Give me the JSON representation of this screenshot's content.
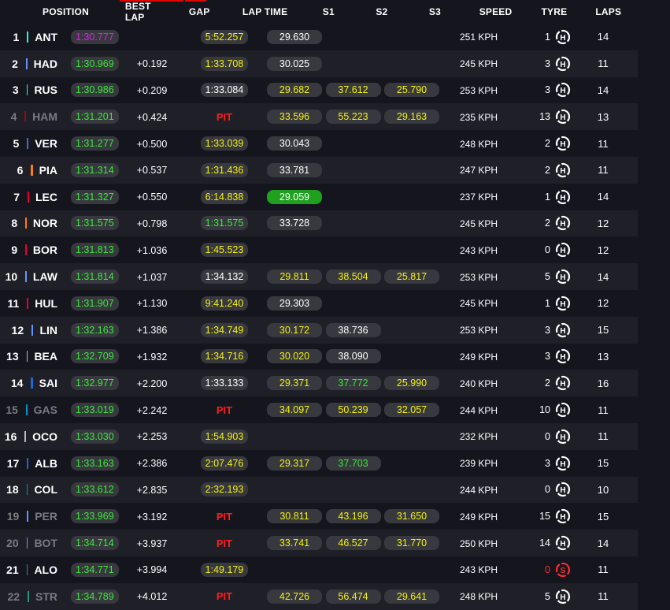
{
  "header": {
    "position": "POSITION",
    "best_lap": "BEST LAP",
    "gap": "GAP",
    "lap_time": "LAP TIME",
    "s1": "S1",
    "s2": "S2",
    "s3": "S3",
    "speed": "SPEED",
    "tyre": "TYRE",
    "laps": "LAPS"
  },
  "colors": {
    "background": "#15151e",
    "row_alt": "#1f1f27",
    "purple": "#d12bd8",
    "green": "#3be83b",
    "yellow": "#f2f20f",
    "pit": "#ff1d1d",
    "accent": "#e10600"
  },
  "rows": [
    {
      "pos": "1",
      "team_color": "#27f4d2",
      "driver": "ANT",
      "best": "1:30.777",
      "best_c": "purple",
      "gap": "",
      "lap": "5:52.257",
      "lap_c": "yellow",
      "s1": "29.630",
      "s1_c": "white",
      "s2": "",
      "s2_c": "",
      "s3": "",
      "s3_c": "",
      "speed": "251 KPH",
      "stint": "1",
      "tyre": "H",
      "laps": "14",
      "pit": false
    },
    {
      "pos": "2",
      "team_color": "#6692ff",
      "driver": "HAD",
      "best": "1:30.969",
      "best_c": "green",
      "gap": "+0.192",
      "lap": "1:33.708",
      "lap_c": "yellow",
      "s1": "30.025",
      "s1_c": "white",
      "s2": "",
      "s2_c": "",
      "s3": "",
      "s3_c": "",
      "speed": "245 KPH",
      "stint": "3",
      "tyre": "H",
      "laps": "11",
      "pit": false
    },
    {
      "pos": "3",
      "team_color": "#27f4d2",
      "driver": "RUS",
      "best": "1:30.986",
      "best_c": "green",
      "gap": "+0.209",
      "lap": "1:33.084",
      "lap_c": "white",
      "s1": "29.682",
      "s1_c": "yellow",
      "s2": "37.612",
      "s2_c": "yellow",
      "s3": "25.790",
      "s3_c": "yellow",
      "speed": "253 KPH",
      "stint": "3",
      "tyre": "H",
      "laps": "14",
      "pit": false
    },
    {
      "pos": "4",
      "team_color": "#8b0a1e",
      "driver": "HAM",
      "best": "1:31.201",
      "best_c": "green",
      "gap": "+0.424",
      "lap": "PIT",
      "lap_c": "pit",
      "s1": "33.596",
      "s1_c": "yellow",
      "s2": "55.223",
      "s2_c": "yellow",
      "s3": "29.163",
      "s3_c": "yellow",
      "speed": "235 KPH",
      "stint": "13",
      "tyre": "H",
      "laps": "13",
      "pit": true
    },
    {
      "pos": "5",
      "team_color": "#3671c6",
      "driver": "VER",
      "best": "1:31.277",
      "best_c": "green",
      "gap": "+0.500",
      "lap": "1:33.039",
      "lap_c": "yellow",
      "s1": "30.043",
      "s1_c": "white",
      "s2": "",
      "s2_c": "",
      "s3": "",
      "s3_c": "",
      "speed": "248 KPH",
      "stint": "2",
      "tyre": "H",
      "laps": "11",
      "pit": false
    },
    {
      "pos": "6",
      "team_color": "#ff8000",
      "driver": "PIA",
      "best": "1:31.314",
      "best_c": "green",
      "gap": "+0.537",
      "lap": "1:31.436",
      "lap_c": "yellow",
      "s1": "33.781",
      "s1_c": "white",
      "s2": "",
      "s2_c": "",
      "s3": "",
      "s3_c": "",
      "speed": "247 KPH",
      "stint": "2",
      "tyre": "H",
      "laps": "11",
      "pit": false
    },
    {
      "pos": "7",
      "team_color": "#e8002d",
      "driver": "LEC",
      "best": "1:31.327",
      "best_c": "green",
      "gap": "+0.550",
      "lap": "6:14.838",
      "lap_c": "yellow",
      "s1": "29.059",
      "s1_c": "fastbg",
      "s2": "",
      "s2_c": "",
      "s3": "",
      "s3_c": "",
      "speed": "237 KPH",
      "stint": "1",
      "tyre": "H",
      "laps": "14",
      "pit": false
    },
    {
      "pos": "8",
      "team_color": "#ff8000",
      "driver": "NOR",
      "best": "1:31.575",
      "best_c": "green",
      "gap": "+0.798",
      "lap": "1:31.575",
      "lap_c": "green",
      "s1": "33.728",
      "s1_c": "white",
      "s2": "",
      "s2_c": "",
      "s3": "",
      "s3_c": "",
      "speed": "245 KPH",
      "stint": "2",
      "tyre": "H",
      "laps": "12",
      "pit": false
    },
    {
      "pos": "9",
      "team_color": "#e8002d",
      "driver": "BOR",
      "best": "1:31.813",
      "best_c": "green",
      "gap": "+1.036",
      "lap": "1:45.523",
      "lap_c": "yellow",
      "s1": "",
      "s1_c": "",
      "s2": "",
      "s2_c": "",
      "s3": "",
      "s3_c": "",
      "speed": "243 KPH",
      "stint": "0",
      "tyre": "H",
      "laps": "12",
      "pit": false
    },
    {
      "pos": "10",
      "team_color": "#6692ff",
      "driver": "LAW",
      "best": "1:31.814",
      "best_c": "green",
      "gap": "+1.037",
      "lap": "1:34.132",
      "lap_c": "white",
      "s1": "29.811",
      "s1_c": "yellow",
      "s2": "38.504",
      "s2_c": "yellow",
      "s3": "25.817",
      "s3_c": "yellow",
      "speed": "253 KPH",
      "stint": "5",
      "tyre": "H",
      "laps": "14",
      "pit": false
    },
    {
      "pos": "11",
      "team_color": "#e8002d",
      "driver": "HUL",
      "best": "1:31.907",
      "best_c": "green",
      "gap": "+1.130",
      "lap": "9:41.240",
      "lap_c": "yellow",
      "s1": "29.303",
      "s1_c": "white",
      "s2": "",
      "s2_c": "",
      "s3": "",
      "s3_c": "",
      "speed": "245 KPH",
      "stint": "1",
      "tyre": "H",
      "laps": "12",
      "pit": false
    },
    {
      "pos": "12",
      "team_color": "#6692ff",
      "driver": "LIN",
      "best": "1:32.163",
      "best_c": "green",
      "gap": "+1.386",
      "lap": "1:34.749",
      "lap_c": "yellow",
      "s1": "30.172",
      "s1_c": "yellow",
      "s2": "38.736",
      "s2_c": "white",
      "s3": "",
      "s3_c": "",
      "speed": "253 KPH",
      "stint": "3",
      "tyre": "H",
      "laps": "15",
      "pit": false
    },
    {
      "pos": "13",
      "team_color": "#b6babd",
      "driver": "BEA",
      "best": "1:32.709",
      "best_c": "green",
      "gap": "+1.932",
      "lap": "1:34.716",
      "lap_c": "yellow",
      "s1": "30.020",
      "s1_c": "yellow",
      "s2": "38.090",
      "s2_c": "white",
      "s3": "",
      "s3_c": "",
      "speed": "249 KPH",
      "stint": "3",
      "tyre": "H",
      "laps": "13",
      "pit": false
    },
    {
      "pos": "14",
      "team_color": "#1868db",
      "driver": "SAI",
      "best": "1:32.977",
      "best_c": "green",
      "gap": "+2.200",
      "lap": "1:33.133",
      "lap_c": "white",
      "s1": "29.371",
      "s1_c": "yellow",
      "s2": "37.772",
      "s2_c": "green",
      "s3": "25.990",
      "s3_c": "yellow",
      "speed": "240 KPH",
      "stint": "2",
      "tyre": "H",
      "laps": "16",
      "pit": false
    },
    {
      "pos": "15",
      "team_color": "#0093cc",
      "driver": "GAS",
      "best": "1:33.019",
      "best_c": "green",
      "gap": "+2.242",
      "lap": "PIT",
      "lap_c": "pit",
      "s1": "34.097",
      "s1_c": "yellow",
      "s2": "50.239",
      "s2_c": "yellow",
      "s3": "32.057",
      "s3_c": "yellow",
      "speed": "244 KPH",
      "stint": "10",
      "tyre": "H",
      "laps": "11",
      "pit": true
    },
    {
      "pos": "16",
      "team_color": "#b6babd",
      "driver": "OCO",
      "best": "1:33.030",
      "best_c": "green",
      "gap": "+2.253",
      "lap": "1:54.903",
      "lap_c": "yellow",
      "s1": "",
      "s1_c": "",
      "s2": "",
      "s2_c": "",
      "s3": "",
      "s3_c": "",
      "speed": "232 KPH",
      "stint": "0",
      "tyre": "H",
      "laps": "11",
      "pit": false
    },
    {
      "pos": "17",
      "team_color": "#1868db",
      "driver": "ALB",
      "best": "1:33.163",
      "best_c": "green",
      "gap": "+2.386",
      "lap": "2:07.476",
      "lap_c": "yellow",
      "s1": "29.317",
      "s1_c": "yellow",
      "s2": "37.703",
      "s2_c": "green",
      "s3": "",
      "s3_c": "",
      "speed": "239 KPH",
      "stint": "3",
      "tyre": "H",
      "laps": "15",
      "pit": false
    },
    {
      "pos": "18",
      "team_color": "#0093cc",
      "driver": "COL",
      "best": "1:33.612",
      "best_c": "green",
      "gap": "+2.835",
      "lap": "2:32.193",
      "lap_c": "yellow",
      "s1": "",
      "s1_c": "",
      "s2": "",
      "s2_c": "",
      "s3": "",
      "s3_c": "",
      "speed": "244 KPH",
      "stint": "0",
      "tyre": "H",
      "laps": "10",
      "pit": false
    },
    {
      "pos": "19",
      "team_color": "#6692ff",
      "driver": "PER",
      "best": "1:33.969",
      "best_c": "green",
      "gap": "+3.192",
      "lap": "PIT",
      "lap_c": "pit",
      "s1": "30.811",
      "s1_c": "yellow",
      "s2": "43.196",
      "s2_c": "yellow",
      "s3": "31.650",
      "s3_c": "yellow",
      "speed": "249 KPH",
      "stint": "15",
      "tyre": "H",
      "laps": "15",
      "pit": true
    },
    {
      "pos": "20",
      "team_color": "#6692ff",
      "driver": "BOT",
      "best": "1:34.714",
      "best_c": "green",
      "gap": "+3.937",
      "lap": "PIT",
      "lap_c": "pit",
      "s1": "33.741",
      "s1_c": "yellow",
      "s2": "46.527",
      "s2_c": "yellow",
      "s3": "31.770",
      "s3_c": "yellow",
      "speed": "250 KPH",
      "stint": "14",
      "tyre": "H",
      "laps": "14",
      "pit": true
    },
    {
      "pos": "21",
      "team_color": "#229971",
      "driver": "ALO",
      "best": "1:34.771",
      "best_c": "green",
      "gap": "+3.994",
      "lap": "1:49.179",
      "lap_c": "yellow",
      "s1": "",
      "s1_c": "",
      "s2": "",
      "s2_c": "",
      "s3": "",
      "s3_c": "",
      "speed": "243 KPH",
      "stint": "0",
      "stint_c": "red",
      "tyre": "S",
      "laps": "11",
      "pit": false
    },
    {
      "pos": "22",
      "team_color": "#229971",
      "driver": "STR",
      "best": "1:34.789",
      "best_c": "green",
      "gap": "+4.012",
      "lap": "PIT",
      "lap_c": "pit",
      "s1": "42.726",
      "s1_c": "yellow",
      "s2": "56.474",
      "s2_c": "yellow",
      "s3": "29.641",
      "s3_c": "yellow",
      "speed": "248 KPH",
      "stint": "5",
      "tyre": "H",
      "laps": "11",
      "pit": true
    }
  ]
}
